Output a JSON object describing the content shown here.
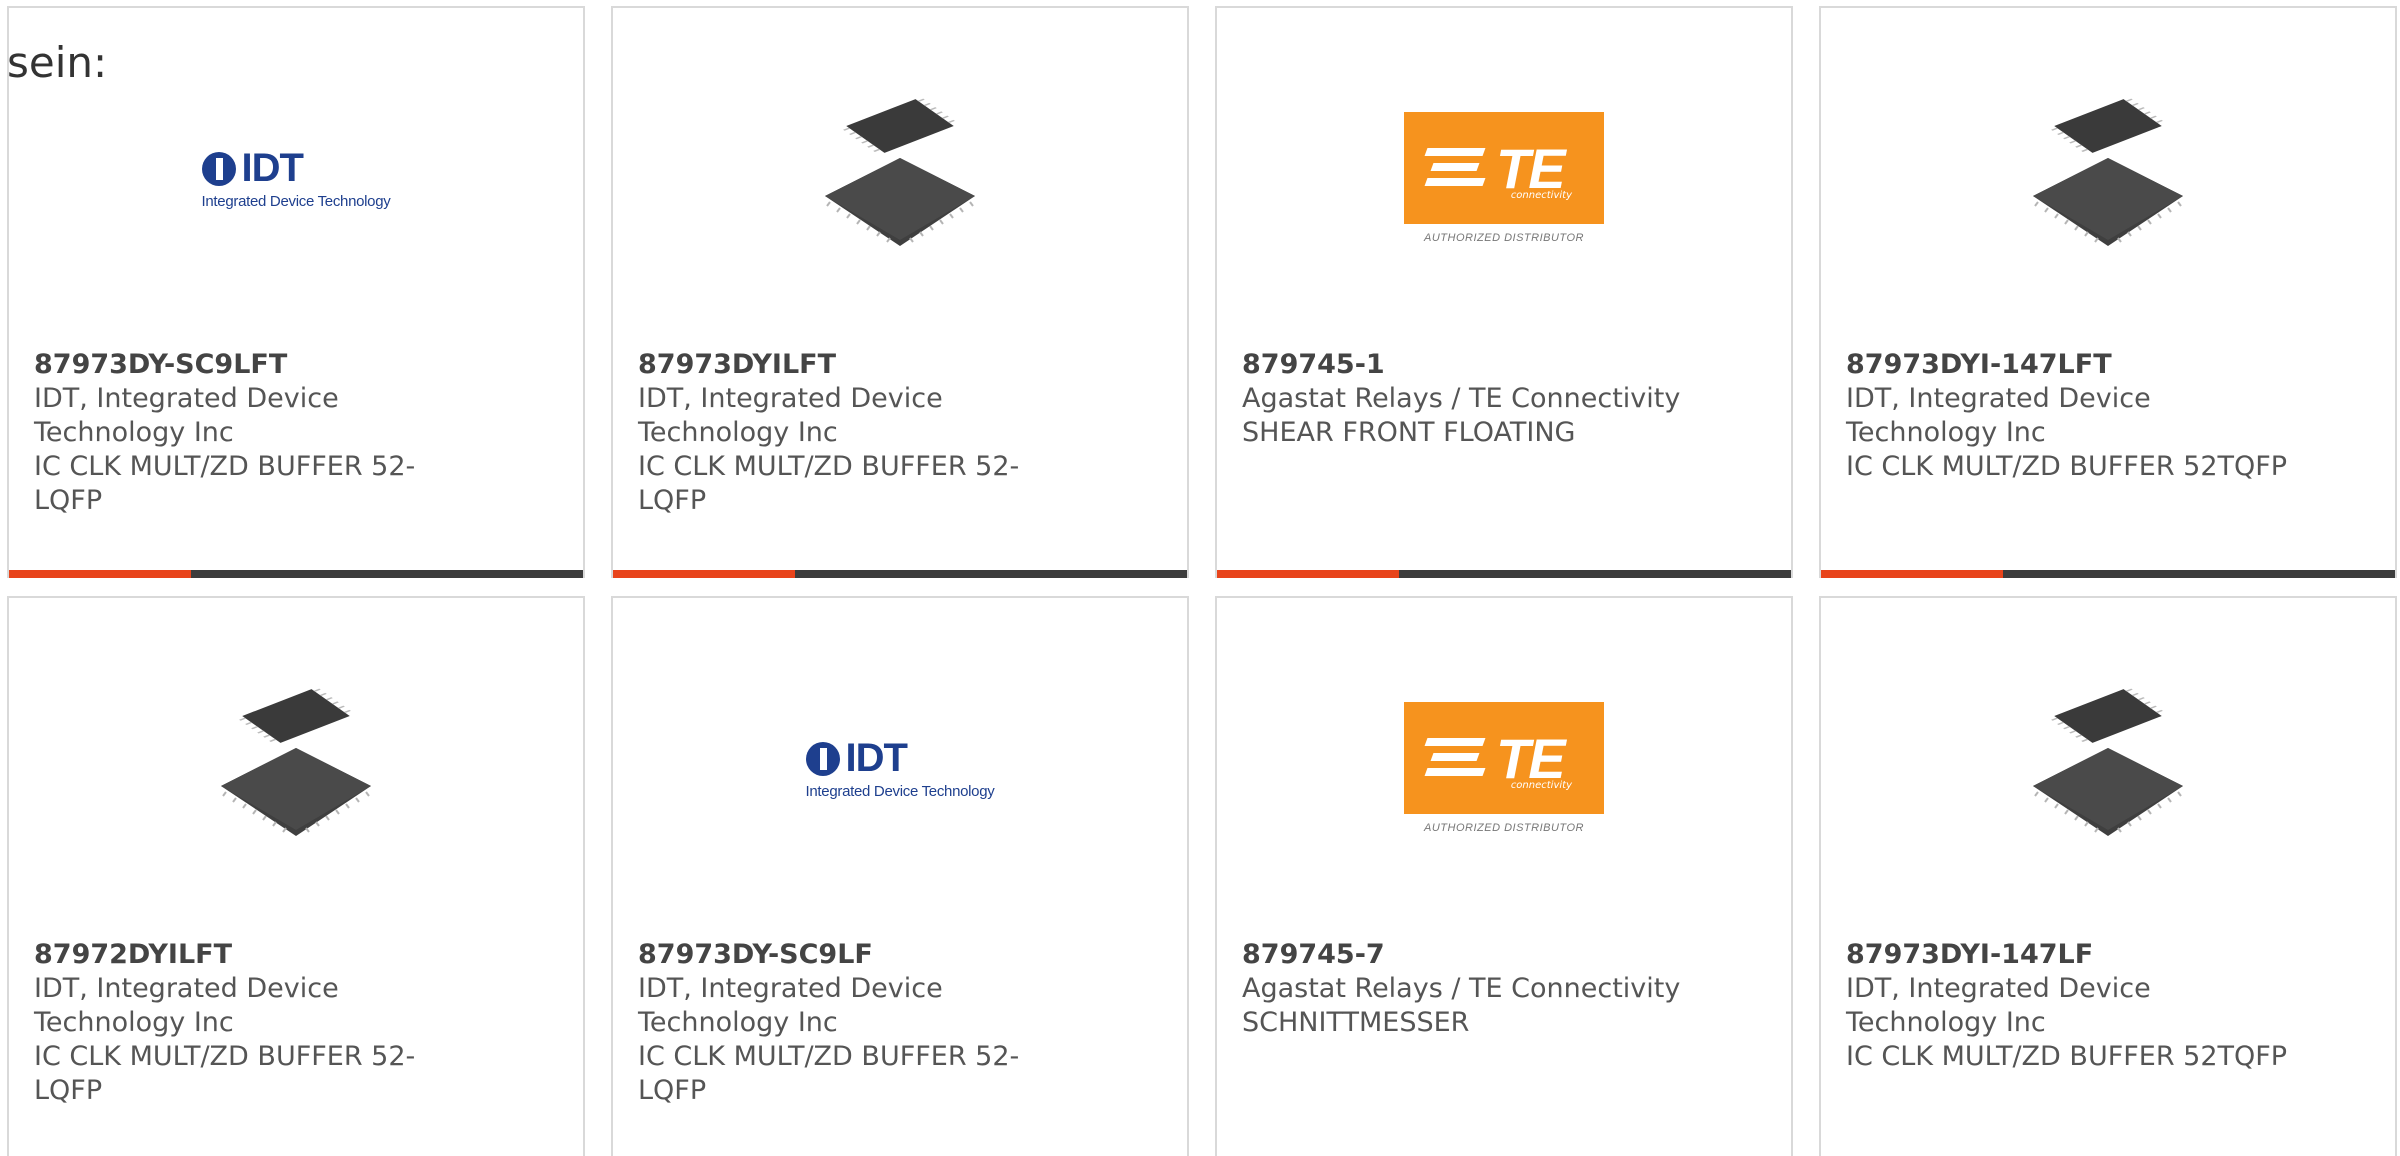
{
  "intro_text": "sein:",
  "colors": {
    "accent": "#e8441b",
    "bar": "#3c3c3c",
    "idt_blue": "#1e3f8e",
    "te_orange": "#f6931e"
  },
  "logos": {
    "idt_word": "IDT",
    "idt_tag": "Integrated Device Technology",
    "te_word": "TE",
    "te_sub": "connectivity",
    "te_auth": "AUTHORIZED DISTRIBUTOR"
  },
  "products": [
    {
      "part": "87973DY-SC9LFT",
      "mfr_line1": "IDT, Integrated Device",
      "mfr_line2": "Technology Inc",
      "desc_line1": "IC CLK MULT/ZD BUFFER 52-",
      "desc_line2": "LQFP",
      "image": "idt-logo"
    },
    {
      "part": "87973DYILFT",
      "mfr_line1": "IDT, Integrated Device",
      "mfr_line2": "Technology Inc",
      "desc_line1": "IC CLK MULT/ZD BUFFER 52-",
      "desc_line2": "LQFP",
      "image": "qfp-chip"
    },
    {
      "part": "879745-1",
      "mfr_line1": "Agastat Relays / TE Connectivity",
      "mfr_line2": "",
      "desc_line1": "SHEAR FRONT FLOATING",
      "desc_line2": "",
      "image": "te-logo"
    },
    {
      "part": "87973DYI-147LFT",
      "mfr_line1": "IDT, Integrated Device",
      "mfr_line2": "Technology Inc",
      "desc_line1": "IC CLK MULT/ZD BUFFER 52TQFP",
      "desc_line2": "",
      "image": "qfp-chip"
    },
    {
      "part": "87972DYILFT",
      "mfr_line1": "IDT, Integrated Device",
      "mfr_line2": "Technology Inc",
      "desc_line1": "IC CLK MULT/ZD BUFFER 52-",
      "desc_line2": "LQFP",
      "image": "qfp-chip"
    },
    {
      "part": "87973DY-SC9LF",
      "mfr_line1": "IDT, Integrated Device",
      "mfr_line2": "Technology Inc",
      "desc_line1": "IC CLK MULT/ZD BUFFER 52-",
      "desc_line2": "LQFP",
      "image": "idt-logo"
    },
    {
      "part": "879745-7",
      "mfr_line1": "Agastat Relays / TE Connectivity",
      "mfr_line2": "",
      "desc_line1": "SCHNITTMESSER",
      "desc_line2": "",
      "image": "te-logo"
    },
    {
      "part": "87973DYI-147LF",
      "mfr_line1": "IDT, Integrated Device",
      "mfr_line2": "Technology Inc",
      "desc_line1": "IC CLK MULT/ZD BUFFER 52TQFP",
      "desc_line2": "",
      "image": "qfp-chip"
    }
  ]
}
